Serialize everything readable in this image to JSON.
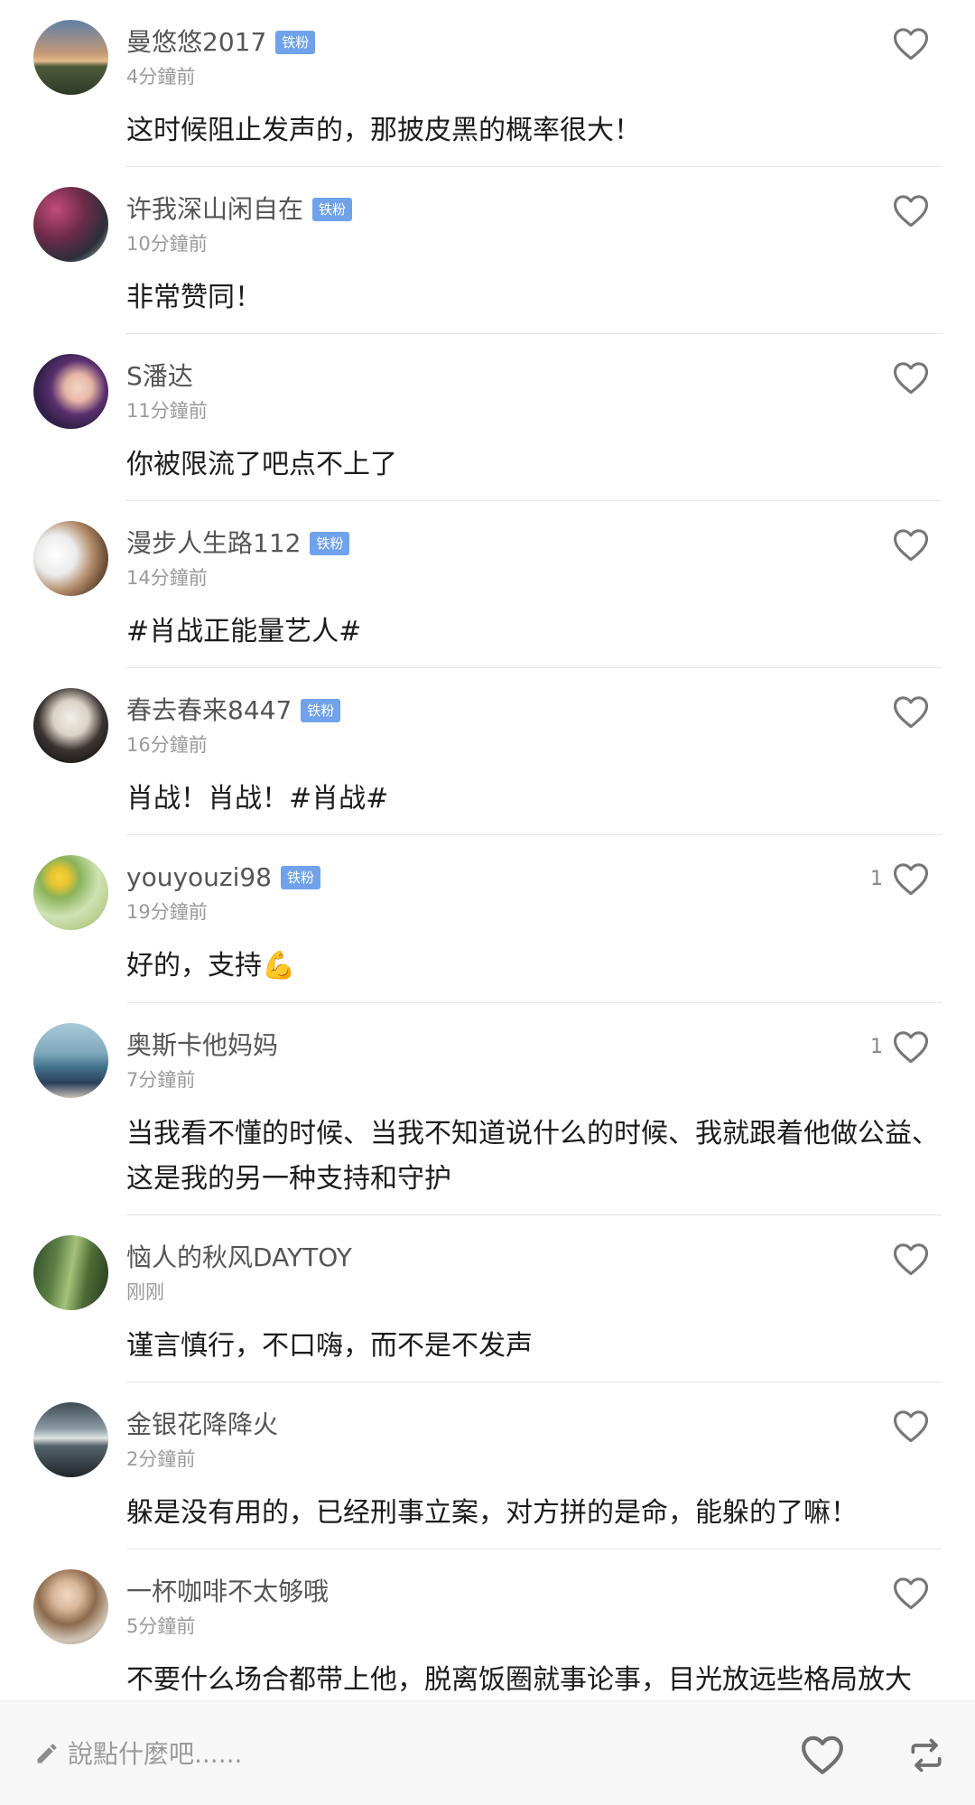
{
  "comments": [
    {
      "user": "曼悠悠2017",
      "badge": "铁粉",
      "time": "4分鐘前",
      "text": "这时候阻止发声的，那披皮黑的概率很大！",
      "likes": ""
    },
    {
      "user": "许我深山闲自在",
      "badge": "铁粉",
      "time": "10分鐘前",
      "text": "非常赞同！",
      "likes": ""
    },
    {
      "user": "S潘达",
      "badge": "",
      "time": "11分鐘前",
      "text": "你被限流了吧点不上了",
      "likes": ""
    },
    {
      "user": "漫步人生路112",
      "badge": "铁粉",
      "time": "14分鐘前",
      "text": "#肖战正能量艺人#",
      "likes": ""
    },
    {
      "user": "春去春来8447",
      "badge": "铁粉",
      "time": "16分鐘前",
      "text": "肖战！肖战！#肖战#",
      "likes": ""
    },
    {
      "user": "youyouzi98",
      "badge": "铁粉",
      "time": "19分鐘前",
      "text": "好的，支持💪",
      "likes": "1"
    },
    {
      "user": "奥斯卡他妈妈",
      "badge": "",
      "time": "7分鐘前",
      "text": "当我看不懂的时候、当我不知道说什么的时候、我就跟着他做公益、这是我的另一种支持和守护",
      "likes": "1"
    },
    {
      "user": "恼人的秋风DAYTOY",
      "badge": "",
      "time": "刚刚",
      "text": "谨言慎行，不口嗨，而不是不发声",
      "likes": ""
    },
    {
      "user": "金银花降降火",
      "badge": "",
      "time": "2分鐘前",
      "text": "躲是没有用的，已经刑事立案，对方拼的是命，能躲的了嘛！",
      "likes": ""
    },
    {
      "user": "一杯咖啡不太够哦",
      "badge": "",
      "time": "5分鐘前",
      "text": "不要什么场合都带上他，脱离饭圈就事论事，目光放远些格局放大",
      "likes": ""
    }
  ],
  "bottom_bar": {
    "input_placeholder": "說點什麼吧......",
    "icons": [
      "pencil-icon",
      "heart-icon",
      "repost-icon"
    ]
  },
  "colors": {
    "badge": "#6fa2ea",
    "text": "#1c1c1c",
    "meta": "#9a9a9a"
  }
}
